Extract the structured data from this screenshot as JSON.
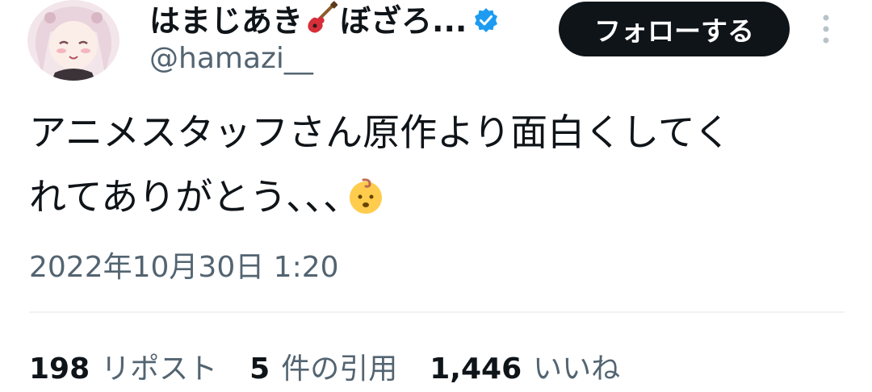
{
  "author": {
    "display_name_part1": "はまじあき",
    "display_name_emoji": "guitar-emoji",
    "display_name_part2": "ぼざろ...",
    "verified": true,
    "handle": "@hamazi__",
    "avatar": "avatar-image"
  },
  "follow_button": {
    "label": "フォローする"
  },
  "more_icon": "more-vertical-icon",
  "tweet": {
    "line1": "アニメスタッフさん原作より面白くしてく",
    "line2": "れてありがとう､､､",
    "emoji": "baby-emoji"
  },
  "timestamp": "2022年10月30日 1:20",
  "stats": {
    "reposts": {
      "count": "198",
      "label": "リポスト"
    },
    "quotes": {
      "count": "5",
      "label": "件の引用"
    },
    "likes": {
      "count": "1,446",
      "label": "いいね"
    }
  },
  "colors": {
    "text_primary": "#0f1419",
    "text_secondary": "#536471",
    "verified_blue": "#1d9bf0",
    "follow_bg": "#0f1419",
    "divider": "#eff3f4"
  }
}
